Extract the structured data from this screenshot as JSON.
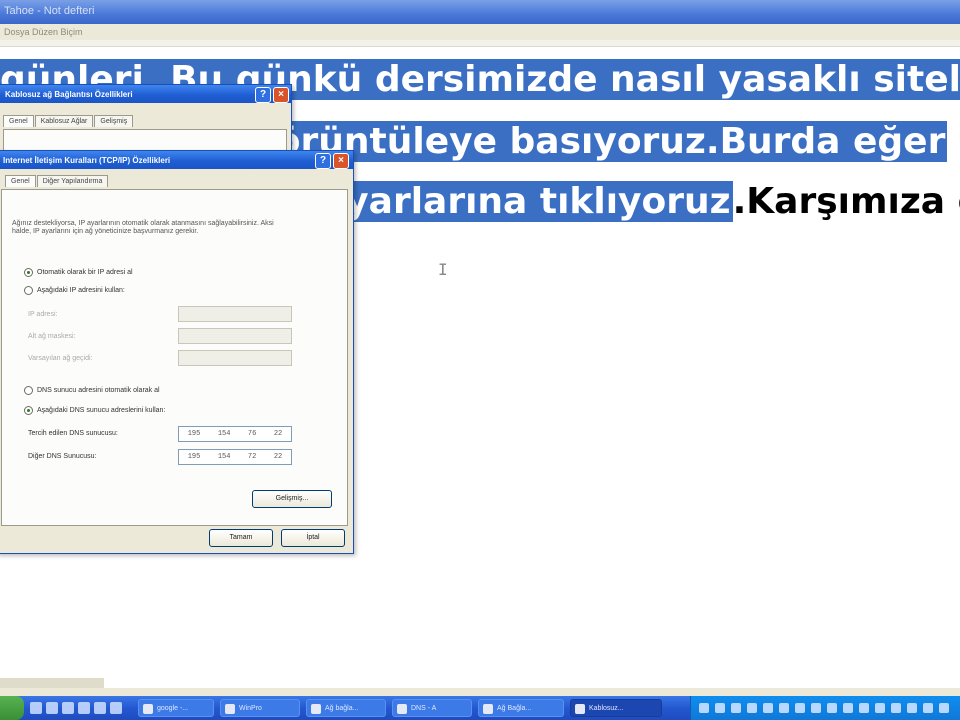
{
  "app": {
    "title": "Tahoe - Not defteri",
    "menu": "Dosya  Düzen  Biçim"
  },
  "document": {
    "line1_highlighted": "günleri. Bu günkü dersimizde nasıl yasaklı sitele",
    "line2_highlighted": "görüntüleye basıyoruz.Burda eğer",
    "line3_highlighted": "ayarlarına tıklıyoruz",
    "line3_plain": ".Karşımıza ç",
    "cursor": "I"
  },
  "back_dialog": {
    "title": "Kablosuz ağ Bağlantısı Özellikleri",
    "tabs": [
      "Genel",
      "Kablosuz Ağlar",
      "Gelişmiş"
    ]
  },
  "front_dialog": {
    "title": "Internet İletişim Kuralları (TCP/IP) Özellikleri",
    "tabs": [
      "Genel",
      "Diğer Yapılandırma"
    ],
    "description": "Ağınız destekliyorsa, IP ayarlarının otomatik olarak atanmasını sağlayabilirsiniz. Aksi halde, IP ayarlarını için ağ yöneticinize başvurmanız gerekir.",
    "ip_auto_label": "Otomatik olarak bir IP adresi al",
    "ip_manual_label": "Aşağıdaki IP adresini kullan:",
    "ip_fields": [
      "IP adresi:",
      "Alt ağ maskesi:",
      "Varsayılan ağ geçidi:"
    ],
    "dns_auto_label": "DNS sunucu adresini otomatik olarak al",
    "dns_manual_label": "Aşağıdaki DNS sunucu adreslerini kullan:",
    "preferred_dns_label": "Tercih edilen DNS sunucusu:",
    "alternate_dns_label": "Diğer DNS Sunucusu:",
    "preferred_dns": [
      "195",
      "154",
      "76",
      "22"
    ],
    "alternate_dns": [
      "195",
      "154",
      "72",
      "22"
    ],
    "advanced_button": "Gelişmiş...",
    "ok_button": "Tamam",
    "cancel_button": "İptal"
  },
  "taskbar": {
    "buttons": [
      "google -...",
      "WinPro",
      "Ağ bağla...",
      "DNS - A",
      "Ağ Bağla...",
      "Kablosuz..."
    ]
  },
  "colors": {
    "selection": "#3a6fc4",
    "titlebar": "#1f5fd3",
    "taskbar": "#2458d0",
    "dialog_bg": "#ece9d8"
  }
}
